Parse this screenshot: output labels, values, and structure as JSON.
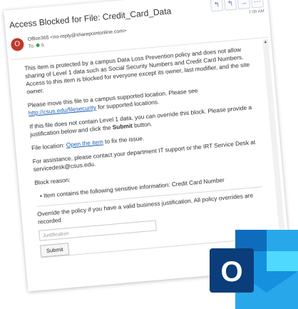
{
  "email": {
    "subject": "Access Blocked for File:  Credit_Card_Data",
    "time": "7:00 AM",
    "sender_initial": "O",
    "sender": "Office365 <no-reply@sharepointonline.com>",
    "to_label": "To",
    "to_value": "6",
    "actions": {
      "reply": "↰",
      "reply_all": "↰",
      "forward": "→",
      "more": "···"
    },
    "p1": "This item is protected by a campus Data Loss Prevention policy and does not allow sharing of Level 1 data such as Social Security Numbers and Credit Card Numbers. Access to this item is blocked for everyone except its owner, last modifier, and the site owner.",
    "p2_before": "Please move this file to a campus supported location. Please see",
    "p2_link": "http://csus.edu/filesecurity",
    "p2_after": "for supported locations.",
    "p3_before": "If this file does not contain Level 1 data, you can override this block. Please provide a justification below and click the",
    "p3_bold": "Submit",
    "p3_after": "button.",
    "p4_before": "File location:",
    "p4_link": "Open the item",
    "p4_after": "to fix the issue.",
    "p5": "For assistance, please contact your department IT support or the IRT Service Desk at servicedesk@csus.edu.",
    "block_reason_label": "Block reason:",
    "block_reason_item": "• Item contains the following sensitive information: Credit Card Number",
    "override_text": "Override the policy if you have a valid business justification. All policy overrides are recorded",
    "justification_placeholder": "Justification",
    "submit_label": "Submit"
  },
  "logo": {
    "letter": "O",
    "colors": {
      "dark": "#0a3d7a",
      "mid": "#0f6cbd",
      "light": "#28a8ea",
      "lighter": "#50d9ff",
      "envelope": "#1490df"
    }
  }
}
